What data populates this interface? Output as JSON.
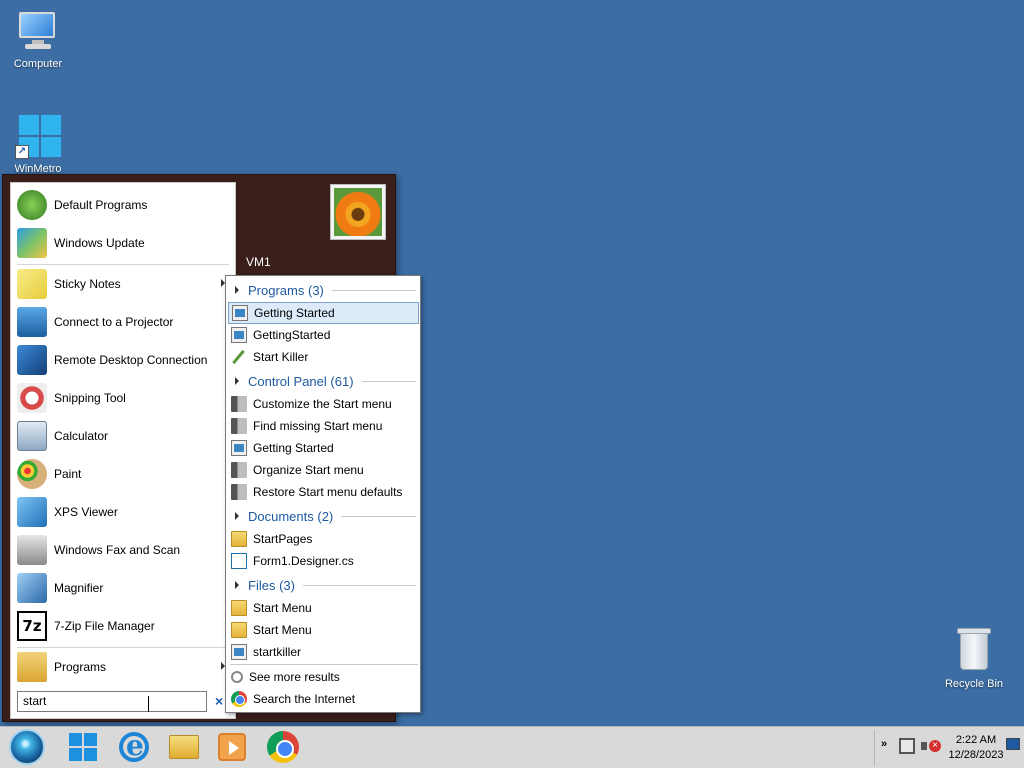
{
  "desktop": {
    "icons": [
      {
        "label": "Computer"
      },
      {
        "label": "WinMetro"
      },
      {
        "label": "Recycle Bin"
      }
    ]
  },
  "start_menu": {
    "user_name": "VM1",
    "pinned": [
      {
        "label": "Default Programs",
        "icon": "default-programs-icon"
      },
      {
        "label": "Windows Update",
        "icon": "windows-update-icon"
      }
    ],
    "recent": [
      {
        "label": "Sticky Notes",
        "icon": "sticky-notes-icon",
        "has_submenu": true
      },
      {
        "label": "Connect to a Projector",
        "icon": "projector-icon"
      },
      {
        "label": "Remote Desktop Connection",
        "icon": "remote-desktop-icon"
      },
      {
        "label": "Snipping Tool",
        "icon": "scissors-icon"
      },
      {
        "label": "Calculator",
        "icon": "calculator-icon"
      },
      {
        "label": "Paint",
        "icon": "paint-palette-icon"
      },
      {
        "label": "XPS Viewer",
        "icon": "xps-viewer-icon"
      },
      {
        "label": "Windows Fax and Scan",
        "icon": "fax-icon"
      },
      {
        "label": "Magnifier",
        "icon": "magnifier-icon"
      },
      {
        "label": "7-Zip File Manager",
        "icon": "7zip-icon"
      }
    ],
    "all_programs_label": "Programs",
    "search": {
      "value": "start",
      "clear_glyph": "×"
    }
  },
  "results": {
    "groups": [
      {
        "header": "Programs",
        "count": "(3)",
        "items": [
          {
            "label": "Getting Started",
            "icon": "app",
            "selected": true
          },
          {
            "label": "GettingStarted",
            "icon": "app"
          },
          {
            "label": "Start Killer",
            "icon": "knife"
          }
        ]
      },
      {
        "header": "Control Panel",
        "count": "(61)",
        "items": [
          {
            "label": "Customize the Start menu",
            "icon": "tool"
          },
          {
            "label": "Find missing Start menu",
            "icon": "tool"
          },
          {
            "label": "Getting Started",
            "icon": "app"
          },
          {
            "label": "Organize Start menu",
            "icon": "tool"
          },
          {
            "label": "Restore Start menu defaults",
            "icon": "tool"
          }
        ]
      },
      {
        "header": "Documents",
        "count": "(2)",
        "items": [
          {
            "label": "StartPages",
            "icon": "folder"
          },
          {
            "label": "Form1.Designer.cs",
            "icon": "doc"
          }
        ]
      },
      {
        "header": "Files",
        "count": "(3)",
        "items": [
          {
            "label": "Start Menu",
            "icon": "folder"
          },
          {
            "label": "Start Menu",
            "icon": "folder"
          },
          {
            "label": "startkiller",
            "icon": "app"
          }
        ]
      }
    ],
    "see_more": "See more results",
    "search_internet": "Search the Internet"
  },
  "taskbar": {
    "buttons": [
      "start-orb",
      "winmetro",
      "internet-explorer",
      "file-explorer",
      "media-player",
      "chrome"
    ],
    "clock_time": "2:22 AM",
    "clock_date": "12/28/2023",
    "tray_chevron": "»"
  }
}
